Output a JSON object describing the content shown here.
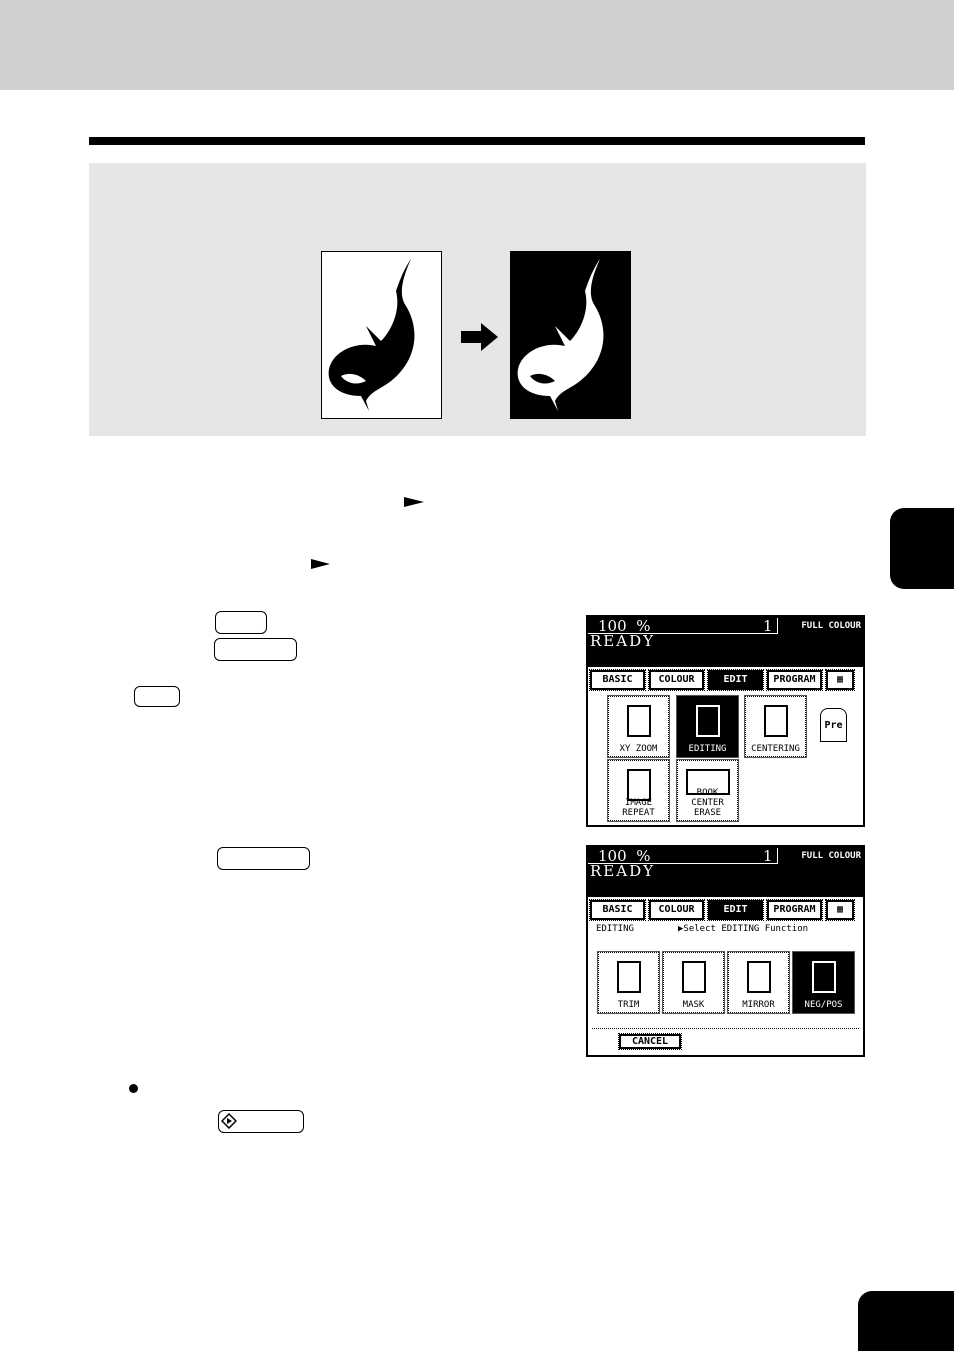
{
  "screen1": {
    "zoom": "100",
    "percent": "%",
    "count": "1",
    "mode": "FULL COLOUR",
    "status": "READY",
    "tabs": [
      "BASIC",
      "COLOUR",
      "EDIT",
      "PROGRAM"
    ],
    "icons": [
      "XY ZOOM",
      "EDITING",
      "CENTERING",
      "IMAGE REPEAT",
      "BOOK CENTER ERASE"
    ],
    "preset": "Pre"
  },
  "screen2": {
    "zoom": "100",
    "percent": "%",
    "count": "1",
    "mode": "FULL COLOUR",
    "status": "READY",
    "tabs": [
      "BASIC",
      "COLOUR",
      "EDIT",
      "PROGRAM"
    ],
    "section": "EDITING",
    "prompt": "▶Select EDITING Function",
    "icons": [
      "TRIM",
      "MASK",
      "MIRROR",
      "NEG/POS"
    ],
    "cancel": "CANCEL"
  }
}
